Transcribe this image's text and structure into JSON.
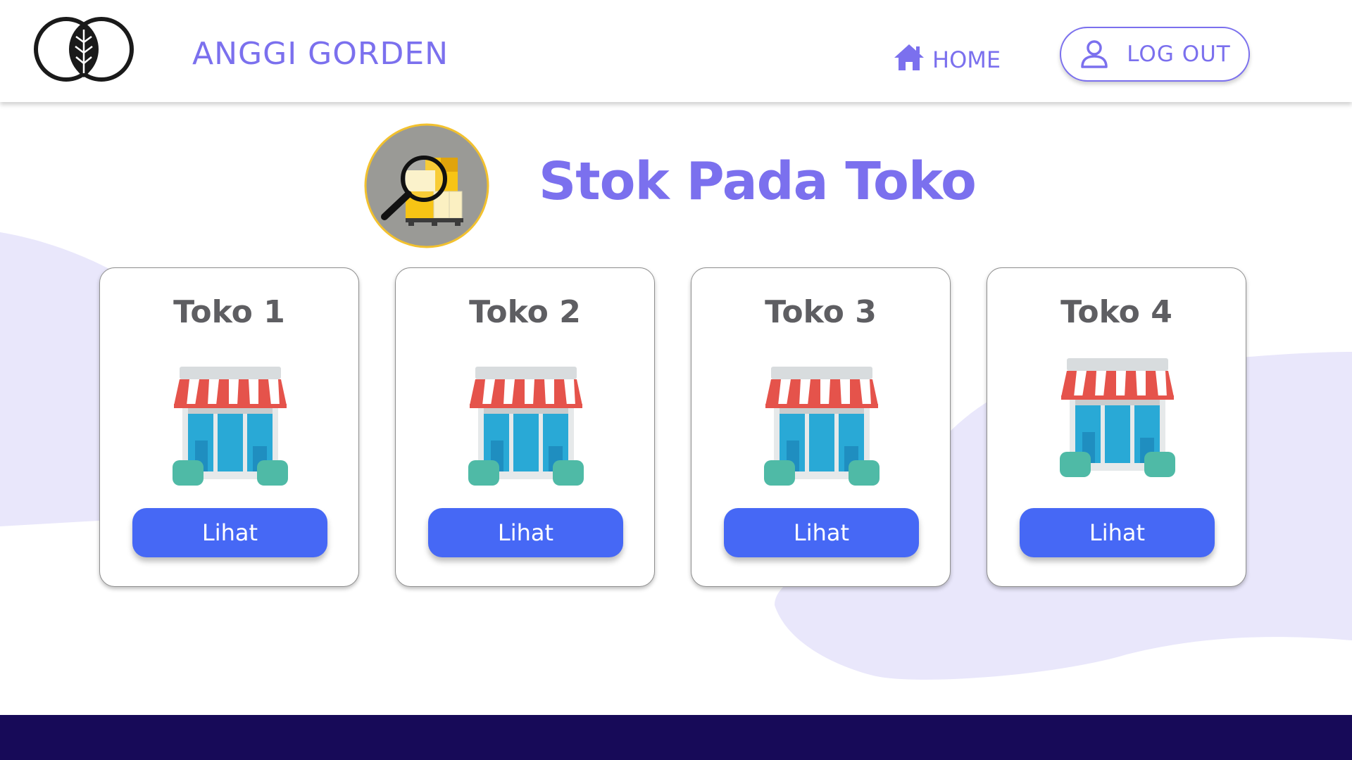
{
  "header": {
    "brand": "ANGGI GORDEN",
    "logo_icon": "leaf-logo-icon",
    "nav": {
      "home_label": "HOME",
      "home_icon": "home-icon",
      "logout_label": "LOG OUT",
      "logout_icon": "user-icon"
    }
  },
  "main": {
    "title": "Stok Pada Toko",
    "title_icon": "inventory-search-icon",
    "stores": [
      {
        "name": "Toko 1",
        "button_label": "Lihat",
        "icon": "store-icon"
      },
      {
        "name": "Toko 2",
        "button_label": "Lihat",
        "icon": "store-icon"
      },
      {
        "name": "Toko 3",
        "button_label": "Lihat",
        "icon": "store-icon"
      },
      {
        "name": "Toko 4",
        "button_label": "Lihat",
        "icon": "store-icon"
      }
    ]
  },
  "colors": {
    "accent": "#7b70ee",
    "button": "#4668f5",
    "footer": "#170a58",
    "background_blob": "#e9e7fb"
  }
}
